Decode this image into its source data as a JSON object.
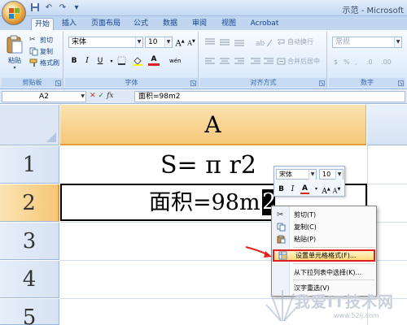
{
  "window": {
    "title": "示范 - Microsoft"
  },
  "tabs": [
    {
      "label": "开始",
      "active": true
    },
    {
      "label": "插入"
    },
    {
      "label": "页面布局"
    },
    {
      "label": "公式"
    },
    {
      "label": "数据"
    },
    {
      "label": "审阅"
    },
    {
      "label": "视图"
    },
    {
      "label": "Acrobat"
    }
  ],
  "ribbon": {
    "clipboard": {
      "label": "剪贴板",
      "paste": "粘贴",
      "cut": "剪切",
      "copy": "复制",
      "format_painter": "格式刷"
    },
    "font": {
      "label": "字体",
      "font_name": "宋体",
      "font_size": "10",
      "grow": "A",
      "shrink": "A",
      "bold": "B",
      "italic": "I",
      "underline": "U",
      "font_color": "A",
      "phonetic": "wén"
    },
    "alignment": {
      "label": "对齐方式",
      "wrap_text": "自动换行",
      "merge_center": "合并后居中"
    },
    "number": {
      "label": "数字",
      "format": "常规"
    }
  },
  "formula_bar": {
    "name_box": "A2",
    "fx": "fx",
    "formula": "面积=98m2"
  },
  "sheet": {
    "column_header": "A",
    "rows": [
      {
        "header": "1",
        "value": "S= π r2"
      },
      {
        "header": "2",
        "value": "面积=98m"
      },
      {
        "header": "3",
        "value": ""
      },
      {
        "header": "4",
        "value": ""
      },
      {
        "header": "5",
        "value": ""
      }
    ],
    "selected_char": "2"
  },
  "mini_toolbar": {
    "font_name": "宋体",
    "font_size": "10",
    "bold": "B",
    "italic": "I",
    "font_color": "A",
    "grow": "A",
    "shrink": "A"
  },
  "context_menu": {
    "items": [
      {
        "label": "剪切(T)",
        "icon": "scissors-icon"
      },
      {
        "label": "复制(C)",
        "icon": "copy-icon"
      },
      {
        "label": "粘贴(P)",
        "icon": "paste-icon"
      },
      {
        "label": "设置单元格格式(F)...",
        "icon": "format-cells-icon",
        "highlighted": true
      },
      {
        "label": "从下拉列表中选择(K)..."
      },
      {
        "label": "汉字重选(V)"
      }
    ]
  },
  "watermark": {
    "text": "我爱IT技术网",
    "url": "www.52ij.com"
  },
  "colors": {
    "accent": "#e59d3b",
    "highlight_border": "#e0201f",
    "ribbon": "#dfe9f6"
  }
}
